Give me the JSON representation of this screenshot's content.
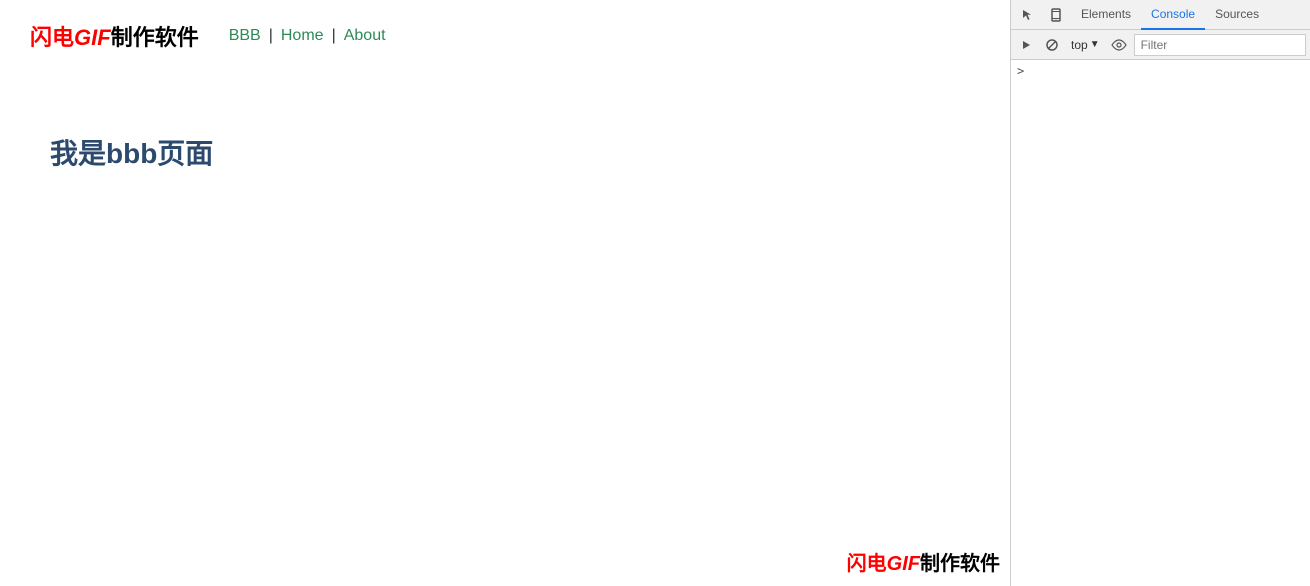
{
  "browser": {
    "logo": {
      "flash": "闪电",
      "gif": "GIF",
      "rest": "制作软件"
    },
    "nav": {
      "bbb": "BBB",
      "separator1": "|",
      "home": "Home",
      "separator2": "|",
      "about": "About"
    },
    "page": {
      "heading": "我是bbb页面"
    },
    "watermark": {
      "flash": "闪电",
      "gif": "GIF",
      "rest": "制作软件"
    }
  },
  "devtools": {
    "tabs": [
      {
        "label": "Elements",
        "active": false
      },
      {
        "label": "Console",
        "active": true
      },
      {
        "label": "Sources",
        "active": false
      }
    ],
    "secondary": {
      "top_label": "top",
      "filter_placeholder": "Filter"
    },
    "console": {
      "chevron": ">"
    }
  }
}
